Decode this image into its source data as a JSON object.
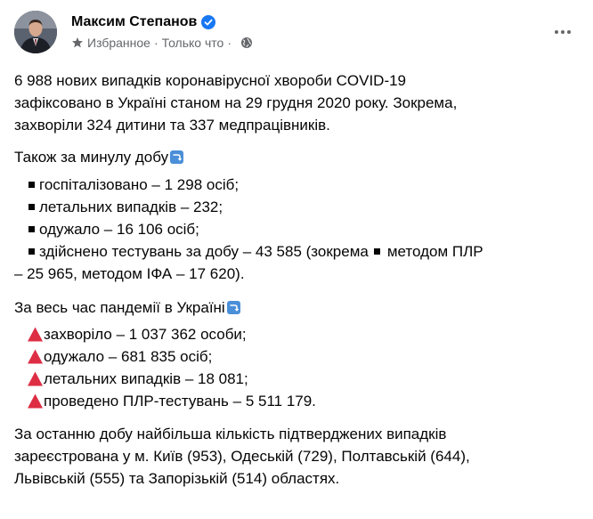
{
  "post": {
    "author": "Максим Степанов",
    "meta": {
      "favorites": "Избранное",
      "separator": "·",
      "time": "Только что"
    },
    "intro_lines": [
      "6 988 нових випадків коронавірусної хвороби COVID-19",
      "зафіксовано в Україні станом на 29 грудня 2020 року. Зокрема,",
      "захворіли 324 дитини та 337 медпрацівників."
    ],
    "daily_heading": "Також за минулу добу",
    "daily_items": [
      "госпіталізовано – 1 298 осіб;",
      "летальних випадків – 232;",
      "одужало – 16 106 осіб;"
    ],
    "daily_tests": {
      "part1": "здійснено тестувань за добу – 43 585 (зокрема",
      "part2": "методом ПЛР",
      "line2": "– 25 965, методом ІФА – 17 620)."
    },
    "pandemic_heading": "За весь час пандемії в Україні",
    "pandemic_items": [
      "захворіло – 1 037 362 особи;",
      "одужало – 681 835 осіб;",
      "летальних випадків – 18 081;",
      "проведено ПЛР-тестувань – 5 511 179."
    ],
    "regions_lines": [
      "За останню добу найбільша кількість підтверджених випадків",
      "зареєстрована у м. Київ (953), Одеській (729), Полтавській (644),",
      "Львівській (555) та Запорізькій (514) областях."
    ]
  },
  "icons": {
    "verified": "verified-badge-icon",
    "favorites": "star-icon",
    "audience": "globe-icon",
    "more": "more-options-icon",
    "heading_emoji": "arrow-turn-down-icon",
    "bullet_daily": "black-square-icon",
    "bullet_pandemic": "red-triangle-icon"
  },
  "colors": {
    "verified": "#1877f2",
    "meta_text": "#65676b",
    "triangle": "#dd2e44",
    "emoji_box": "#4a8fd8"
  }
}
